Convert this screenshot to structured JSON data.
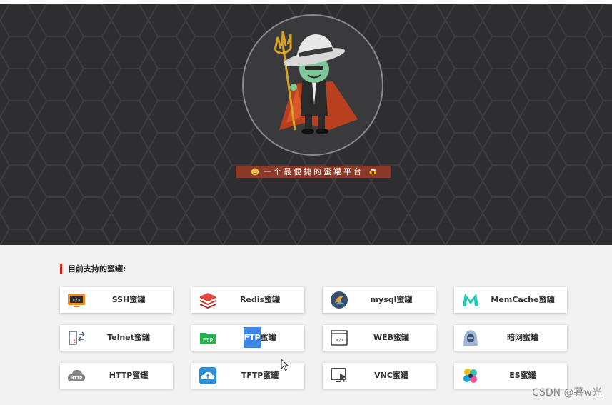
{
  "hero": {
    "slogan": "一个最便捷的蜜罐平台",
    "emoji_left": "smile-emoji-icon",
    "emoji_right": "bee-emoji-icon"
  },
  "section": {
    "title": "目前支持的蜜罐:"
  },
  "cards": [
    {
      "label_pre": "SSH蜜罐",
      "icon": "ssh-terminal-icon"
    },
    {
      "label_pre": "Redis蜜罐",
      "icon": "redis-icon"
    },
    {
      "label_pre": "mysql蜜罐",
      "icon": "mysql-dolphin-icon"
    },
    {
      "label_pre": "MemCache蜜罐",
      "icon": "memcache-icon"
    },
    {
      "label_pre": "Telnet蜜罐",
      "icon": "telnet-icon"
    },
    {
      "label_hl": "FTP",
      "label_post": "蜜罐",
      "icon": "ftp-icon"
    },
    {
      "label_pre": "WEB蜜罐",
      "icon": "web-code-icon"
    },
    {
      "label_pre": "暗网蜜罐",
      "icon": "hacker-hood-icon"
    },
    {
      "label_pre": "HTTP蜜罐",
      "icon": "http-cloud-icon"
    },
    {
      "label_pre": "TFTP蜜罐",
      "icon": "tftp-upload-icon"
    },
    {
      "label_pre": "VNC蜜罐",
      "icon": "vnc-remote-icon"
    },
    {
      "label_pre": "ES蜜罐",
      "icon": "elasticsearch-icon"
    }
  ],
  "watermark": "CSDN @暮w光",
  "colors": {
    "accent": "#d9241b",
    "highlight": "#3b86e8",
    "hero_bg": "#2e2e30"
  }
}
